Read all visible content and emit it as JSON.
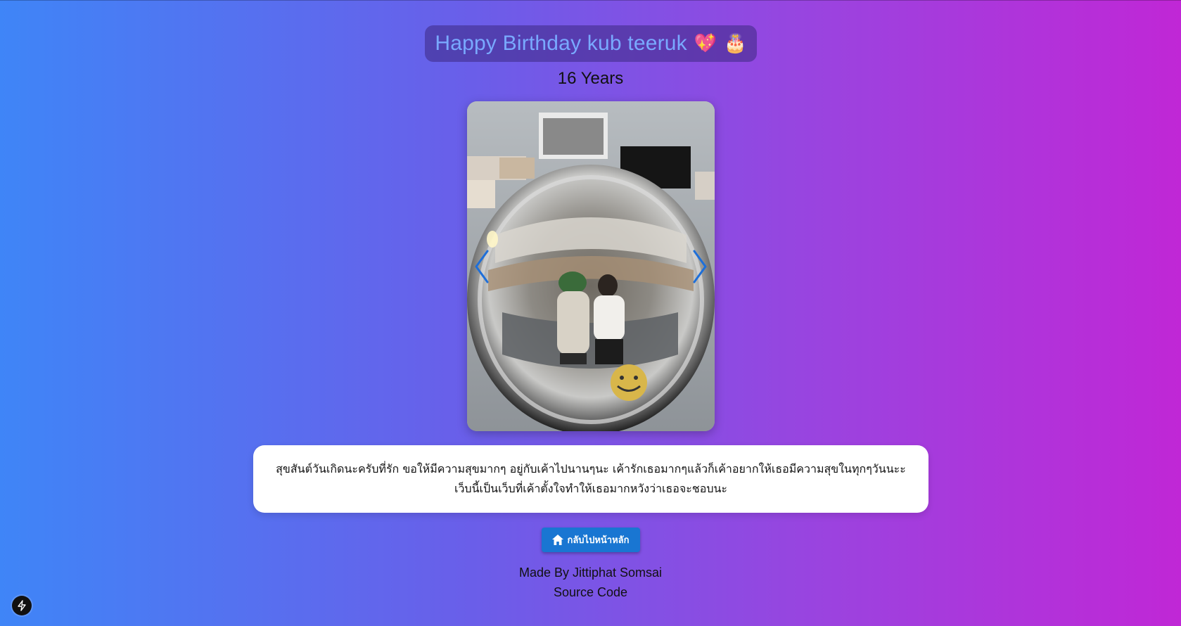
{
  "header": {
    "title": "Happy Birthday kub teeruk",
    "emoji_1": "💖",
    "emoji_2": "🎂",
    "subtitle": "16 Years"
  },
  "carousel": {
    "image_icon": "photo-icon",
    "prev_icon": "chevron-left-icon",
    "next_icon": "chevron-right-icon"
  },
  "message": {
    "line_1": "สุขสันต์วันเกิดนะครับที่รัก ขอให้มีความสุขมากๆ อยู่กับเค้าไปนานๆนะ เค้ารักเธอมากๆแล้วก็เค้าอยากให้เธอมีความสุขในทุกๆวันนะะ",
    "line_2": "เว็บนี้เป็นเว็บที่เค้าตั้งใจทำให้เธอมากหวังว่าเธอจะชอบนะ"
  },
  "home_button": {
    "icon": "home-icon",
    "label": "กลับไปหน้าหลัก"
  },
  "footer": {
    "made_by": "Made By Jittiphat Somsai",
    "source": "Source Code"
  },
  "dev_badge": {
    "icon": "lightning-icon"
  },
  "colors": {
    "gradient_start": "#3f85f7",
    "gradient_end": "#c027d6",
    "title_text": "#79a9ff",
    "button": "#1976d2",
    "arrow": "#1e6fd9"
  }
}
